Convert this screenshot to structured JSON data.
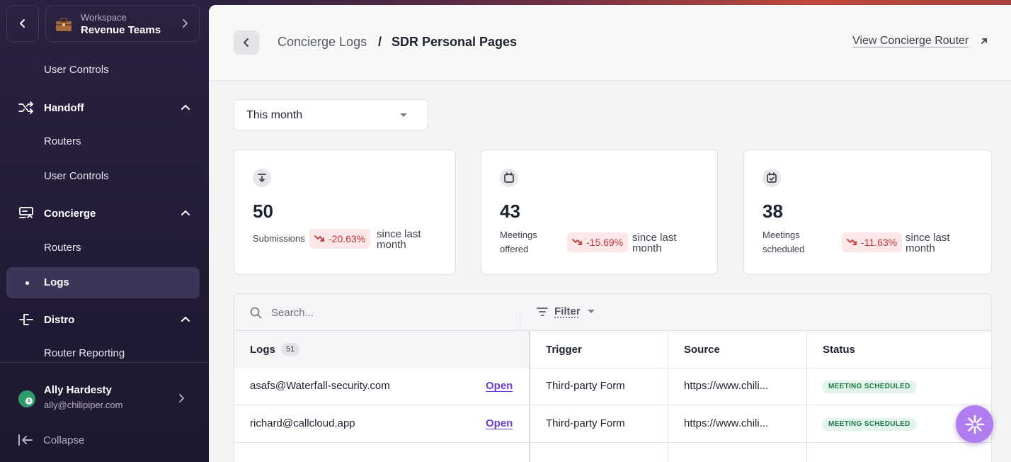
{
  "sidebar": {
    "workspace_label": "Workspace",
    "workspace_name": "Revenue Teams",
    "items": {
      "user_controls_top": "User Controls",
      "handoff": "Handoff",
      "handoff_routers": "Routers",
      "handoff_user_controls": "User Controls",
      "concierge": "Concierge",
      "concierge_routers": "Routers",
      "concierge_logs": "Logs",
      "distro": "Distro",
      "router_reporting": "Router Reporting"
    },
    "user": {
      "name": "Ally Hardesty",
      "email": "ally@chilipiper.com"
    },
    "collapse_label": "Collapse"
  },
  "header": {
    "breadcrumb_parent": "Concierge Logs",
    "breadcrumb_sep": "/",
    "breadcrumb_current": "SDR Personal Pages",
    "view_router_label": "View Concierge Router"
  },
  "period": {
    "selected": "This month"
  },
  "stats": [
    {
      "icon": "download-icon",
      "value": "50",
      "label": "Submissions",
      "delta": "-20.63%",
      "since": "since last month"
    },
    {
      "icon": "calendar-icon",
      "value": "43",
      "label": "Meetings offered",
      "delta": "-15.69%",
      "since": "since last month"
    },
    {
      "icon": "calendar-check-icon",
      "value": "38",
      "label": "Meetings scheduled",
      "delta": "-11.63%",
      "since": "since last month"
    }
  ],
  "table": {
    "search_placeholder": "Search...",
    "filter_label": "Filter",
    "columns": {
      "logs": "Logs",
      "logs_count": "51",
      "trigger": "Trigger",
      "source": "Source",
      "status": "Status"
    },
    "rows": [
      {
        "email": "asafs@Waterfall-security.com",
        "action": "Open",
        "trigger": "Third-party Form",
        "source": "https://www.chili...",
        "status": "MEETING SCHEDULED"
      },
      {
        "email": "richard@callcloud.app",
        "action": "Open",
        "trigger": "Third-party Form",
        "source": "https://www.chili...",
        "status": "MEETING SCHEDULED"
      }
    ]
  },
  "colors": {
    "accent": "#6a3fd0",
    "sidebar_bg": "#241d34",
    "negative": "#c2353a",
    "success": "#1f7a48"
  }
}
